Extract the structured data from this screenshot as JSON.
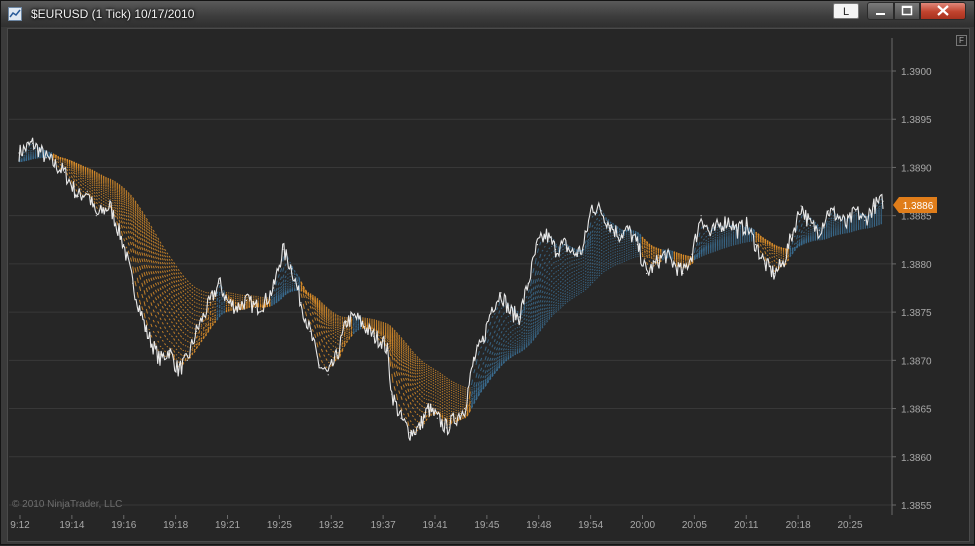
{
  "window": {
    "title": "$EURUSD (1 Tick)  10/17/2010",
    "link_button_label": "L",
    "chart_button_label": "F",
    "copyright": "© 2010 NinjaTrader, LLC"
  },
  "colors": {
    "background": "#262626",
    "price_line": "#e8e8e8",
    "bearish_ribbon": "#d98d2a",
    "bullish_ribbon": "#3b6c8f",
    "price_marker": "#e07d1a"
  },
  "chart_data": {
    "type": "line",
    "title": "",
    "symbol": "$EURUSD",
    "interval": "1 Tick",
    "date": "10/17/2010",
    "current_price": "1.3886",
    "ylim": [
      1.3855,
      1.3903
    ],
    "y_ticks": [
      "1.3900",
      "1.3895",
      "1.3890",
      "1.3885",
      "1.3880",
      "1.3875",
      "1.3870",
      "1.3865",
      "1.3860",
      "1.3855"
    ],
    "x_ticks": [
      "9:12",
      "19:14",
      "19:16",
      "19:18",
      "19:21",
      "19:25",
      "19:32",
      "19:37",
      "19:41",
      "19:45",
      "19:48",
      "19:54",
      "20:00",
      "20:05",
      "20:11",
      "20:18",
      "20:25"
    ],
    "grid": "horizontal",
    "price_points": [
      [
        0,
        1.38915
      ],
      [
        3,
        1.38925
      ],
      [
        6,
        1.3891
      ],
      [
        10,
        1.38895
      ],
      [
        13,
        1.3887
      ],
      [
        15,
        1.38875
      ],
      [
        17,
        1.3885
      ],
      [
        20,
        1.3886
      ],
      [
        23,
        1.3882
      ],
      [
        25,
        1.3878
      ],
      [
        28,
        1.3873
      ],
      [
        31,
        1.387
      ],
      [
        33,
        1.3871
      ],
      [
        35,
        1.3869
      ],
      [
        37,
        1.387
      ],
      [
        39,
        1.3873
      ],
      [
        42,
        1.3876
      ],
      [
        44,
        1.3878
      ],
      [
        46,
        1.3876
      ],
      [
        48,
        1.38755
      ],
      [
        50,
        1.38762
      ],
      [
        52,
        1.38755
      ],
      [
        54,
        1.3876
      ],
      [
        56,
        1.38775
      ],
      [
        58,
        1.38815
      ],
      [
        60,
        1.38795
      ],
      [
        62,
        1.3876
      ],
      [
        64,
        1.3873
      ],
      [
        66,
        1.38695
      ],
      [
        68,
        1.38685
      ],
      [
        70,
        1.38705
      ],
      [
        72,
        1.3874
      ],
      [
        74,
        1.38745
      ],
      [
        76,
        1.38735
      ],
      [
        78,
        1.38725
      ],
      [
        80,
        1.3872
      ],
      [
        81,
        1.3871
      ],
      [
        82,
        1.38665
      ],
      [
        84,
        1.3864
      ],
      [
        86,
        1.38625
      ],
      [
        88,
        1.3863
      ],
      [
        90,
        1.3865
      ],
      [
        92,
        1.3864
      ],
      [
        94,
        1.3863
      ],
      [
        96,
        1.3864
      ],
      [
        98,
        1.3865
      ],
      [
        100,
        1.387
      ],
      [
        102,
        1.3872
      ],
      [
        104,
        1.38755
      ],
      [
        106,
        1.3877
      ],
      [
        108,
        1.3875
      ],
      [
        110,
        1.38745
      ],
      [
        112,
        1.3878
      ],
      [
        114,
        1.3882
      ],
      [
        116,
        1.3883
      ],
      [
        118,
        1.38815
      ],
      [
        120,
        1.3882
      ],
      [
        122,
        1.3881
      ],
      [
        124,
        1.38815
      ],
      [
        126,
        1.3886
      ],
      [
        128,
        1.38855
      ],
      [
        130,
        1.3884
      ],
      [
        132,
        1.3883
      ],
      [
        134,
        1.38835
      ],
      [
        136,
        1.3882
      ],
      [
        138,
        1.3879
      ],
      [
        140,
        1.388
      ],
      [
        142,
        1.3881
      ],
      [
        144,
        1.388
      ],
      [
        146,
        1.3879
      ],
      [
        148,
        1.3881
      ],
      [
        150,
        1.3885
      ],
      [
        152,
        1.3883
      ],
      [
        154,
        1.3884
      ],
      [
        156,
        1.38845
      ],
      [
        158,
        1.38835
      ],
      [
        160,
        1.3884
      ],
      [
        162,
        1.3882
      ],
      [
        164,
        1.388
      ],
      [
        166,
        1.3879
      ],
      [
        168,
        1.388
      ],
      [
        170,
        1.3883
      ],
      [
        172,
        1.3886
      ],
      [
        174,
        1.3884
      ],
      [
        176,
        1.38835
      ],
      [
        178,
        1.38855
      ],
      [
        180,
        1.3885
      ],
      [
        182,
        1.3884
      ],
      [
        184,
        1.38855
      ],
      [
        186,
        1.38845
      ],
      [
        188,
        1.3886
      ],
      [
        190,
        1.38865
      ]
    ]
  }
}
